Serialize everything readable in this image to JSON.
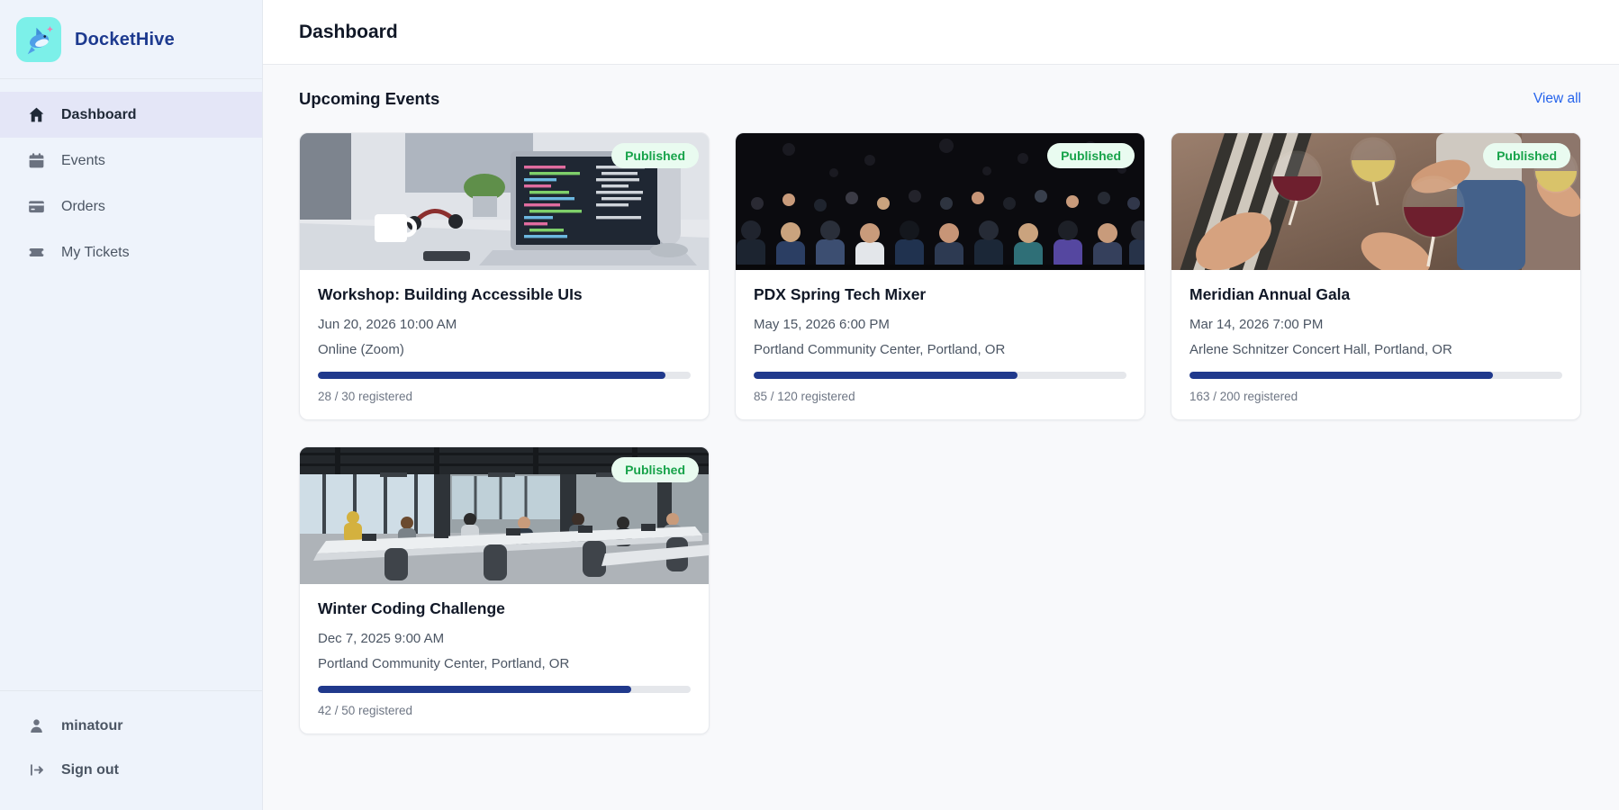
{
  "app": {
    "name": "DocketHive",
    "logo_icon": "dolphin-icon"
  },
  "sidebar": {
    "nav": [
      {
        "label": "Dashboard",
        "icon": "home-icon",
        "active": true
      },
      {
        "label": "Events",
        "icon": "calendar-icon",
        "active": false
      },
      {
        "label": "Orders",
        "icon": "credit-card-icon",
        "active": false
      },
      {
        "label": "My Tickets",
        "icon": "ticket-icon",
        "active": false
      }
    ],
    "user": {
      "label": "minatour",
      "icon": "user-icon"
    },
    "sign_out": {
      "label": "Sign out",
      "icon": "sign-out-icon"
    }
  },
  "header": {
    "title": "Dashboard"
  },
  "main": {
    "section_title": "Upcoming Events",
    "view_all_label": "View all",
    "events": [
      {
        "title": "Workshop: Building Accessible UIs",
        "datetime": "Jun 20, 2026 10:00 AM",
        "location": "Online (Zoom)",
        "status": "Published",
        "registered": 28,
        "capacity": 30,
        "registered_label": "28 / 30 registered",
        "progress_pct": 93.3,
        "image": "laptop-code-workspace-photo"
      },
      {
        "title": "PDX Spring Tech Mixer",
        "datetime": "May 15, 2026 6:00 PM",
        "location": "Portland Community Center, Portland, OR",
        "status": "Published",
        "registered": 85,
        "capacity": 120,
        "registered_label": "85 / 120 registered",
        "progress_pct": 70.8,
        "image": "conference-audience-photo"
      },
      {
        "title": "Meridian Annual Gala",
        "datetime": "Mar 14, 2026 7:00 PM",
        "location": "Arlene Schnitzer Concert Hall, Portland, OR",
        "status": "Published",
        "registered": 163,
        "capacity": 200,
        "registered_label": "163 / 200 registered",
        "progress_pct": 81.5,
        "image": "wine-toast-photo"
      },
      {
        "title": "Winter Coding Challenge",
        "datetime": "Dec 7, 2025 9:00 AM",
        "location": "Portland Community Center, Portland, OR",
        "status": "Published",
        "registered": 42,
        "capacity": 50,
        "registered_label": "42 / 50 registered",
        "progress_pct": 84,
        "image": "open-office-hackathon-photo"
      }
    ]
  },
  "colors": {
    "brand_text": "#1d3a8f",
    "logo_bg": "#7cf0e9",
    "sidebar_bg": "#eef3fb",
    "sidebar_active_bg": "#e4e6f7",
    "accent_link_blue": "#2563eb",
    "progress_fill": "#20398c",
    "progress_track": "#e5e7eb",
    "badge_bg": "#e9fbf0",
    "badge_text": "#17a34a"
  }
}
